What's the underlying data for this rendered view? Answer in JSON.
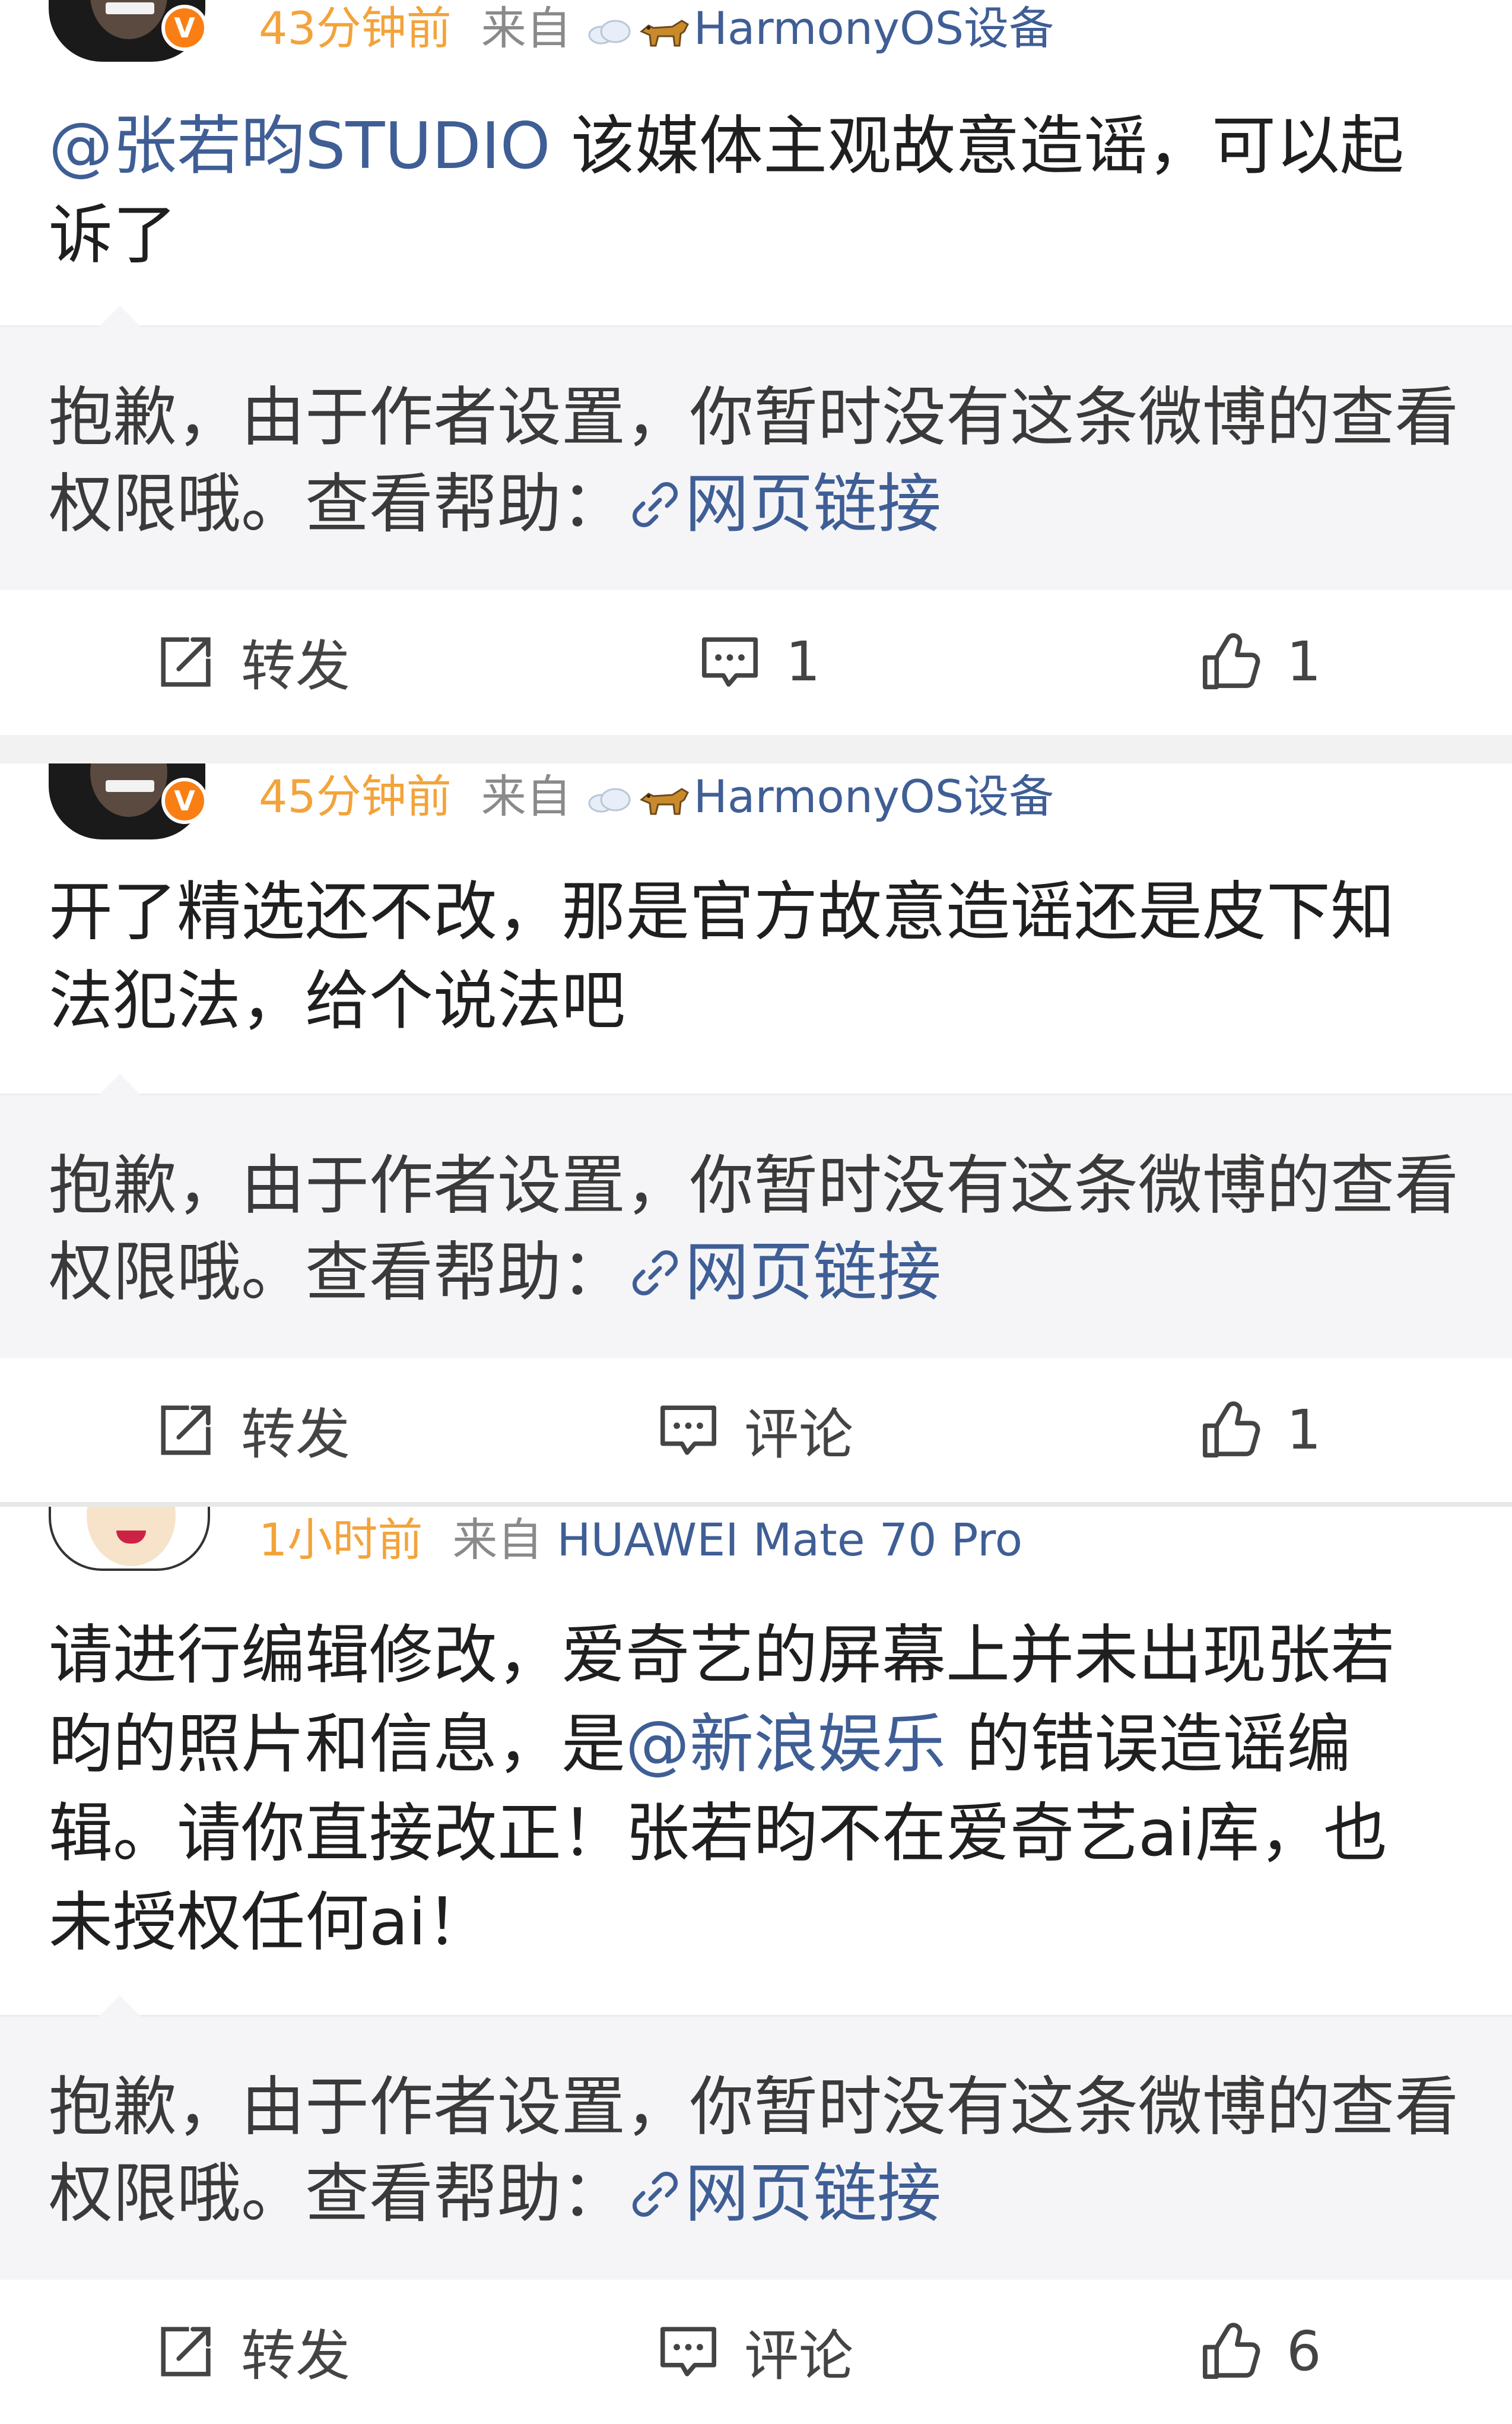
{
  "posts": [
    {
      "time": "43分钟前",
      "from_label": "来自",
      "source": "HarmonyOS设备",
      "source_icons": [
        "cloud-icon",
        "dog-icon"
      ],
      "verified": true,
      "text_mention": "@张若昀STUDIO",
      "text_body": " 该媒体主观故意造谣，可以起诉了",
      "quote_text": "抱歉，由于作者设置，你暂时没有这条微博的查看权限哦。查看帮助：",
      "quote_link": "网页链接",
      "actions": {
        "repost": "转发",
        "comment": "1",
        "like": "1"
      }
    },
    {
      "time": "45分钟前",
      "from_label": "来自",
      "source": "HarmonyOS设备",
      "source_icons": [
        "cloud-icon",
        "dog-icon"
      ],
      "verified": true,
      "text_body": "开了精选还不改，那是官方故意造谣还是皮下知法犯法，给个说法吧",
      "quote_text": "抱歉，由于作者设置，你暂时没有这条微博的查看权限哦。查看帮助：",
      "quote_link": "网页链接",
      "actions": {
        "repost": "转发",
        "comment": "评论",
        "like": "1"
      }
    },
    {
      "time": "1小时前",
      "from_label": "来自",
      "source": "HUAWEI Mate 70 Pro",
      "verified": false,
      "text_part1": "请进行编辑修改，爱奇艺的屏幕上并未出现张若昀的照片和信息，是",
      "text_mention": "@新浪娱乐",
      "text_part2": " 的错误造谣编辑。请你直接改正！张若昀不在爱奇艺ai库，也未授权任何ai！",
      "quote_text": "抱歉，由于作者设置，你暂时没有这条微博的查看权限哦。查看帮助：",
      "quote_link": "网页链接",
      "actions": {
        "repost": "转发",
        "comment": "评论",
        "like": "6"
      }
    }
  ],
  "colors": {
    "time": "#f3a33b",
    "link": "#3f5e95",
    "muted": "#8a8a8a",
    "quote_bg": "#f5f5f7",
    "verified_badge": "#f97f14"
  },
  "icons": {
    "repost": "repost-icon",
    "comment": "comment-icon",
    "like": "like-icon",
    "link": "link-icon",
    "verified": "verified-badge-icon"
  }
}
